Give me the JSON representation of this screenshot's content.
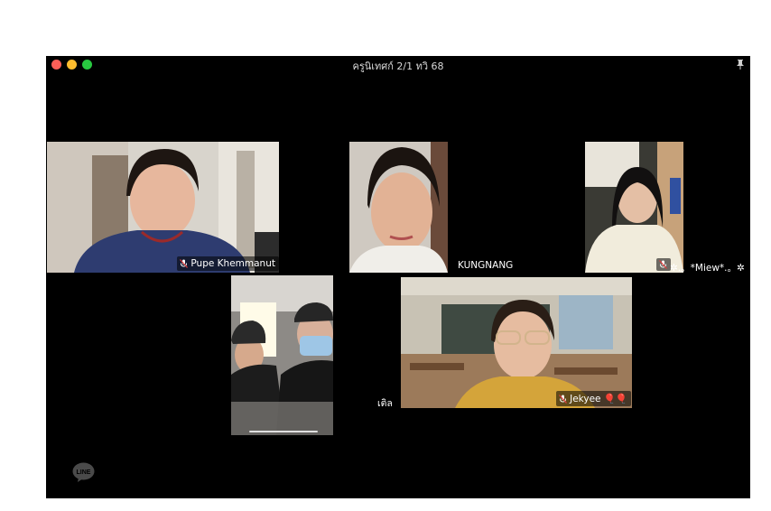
{
  "window": {
    "title": "ครูนิเทศก์ 2/1 ทวิ 68"
  },
  "participants": [
    {
      "name": "Pupe Khemmanut",
      "muted": true
    },
    {
      "name": "KUNGNANG",
      "muted": false
    },
    {
      "name": "✲.。*Miew*.。✲",
      "muted": true
    },
    {
      "name": "เติล",
      "muted": false
    },
    {
      "name": "Jekyee 🎈🎈",
      "muted": true
    }
  ],
  "icons": {
    "app_logo": "line-logo-icon",
    "pin": "pin-icon",
    "mic_off": "mic-off-icon"
  },
  "colors": {
    "background": "#000000",
    "close": "#ff5f57",
    "minimize": "#febc2e",
    "maximize": "#28c840"
  }
}
